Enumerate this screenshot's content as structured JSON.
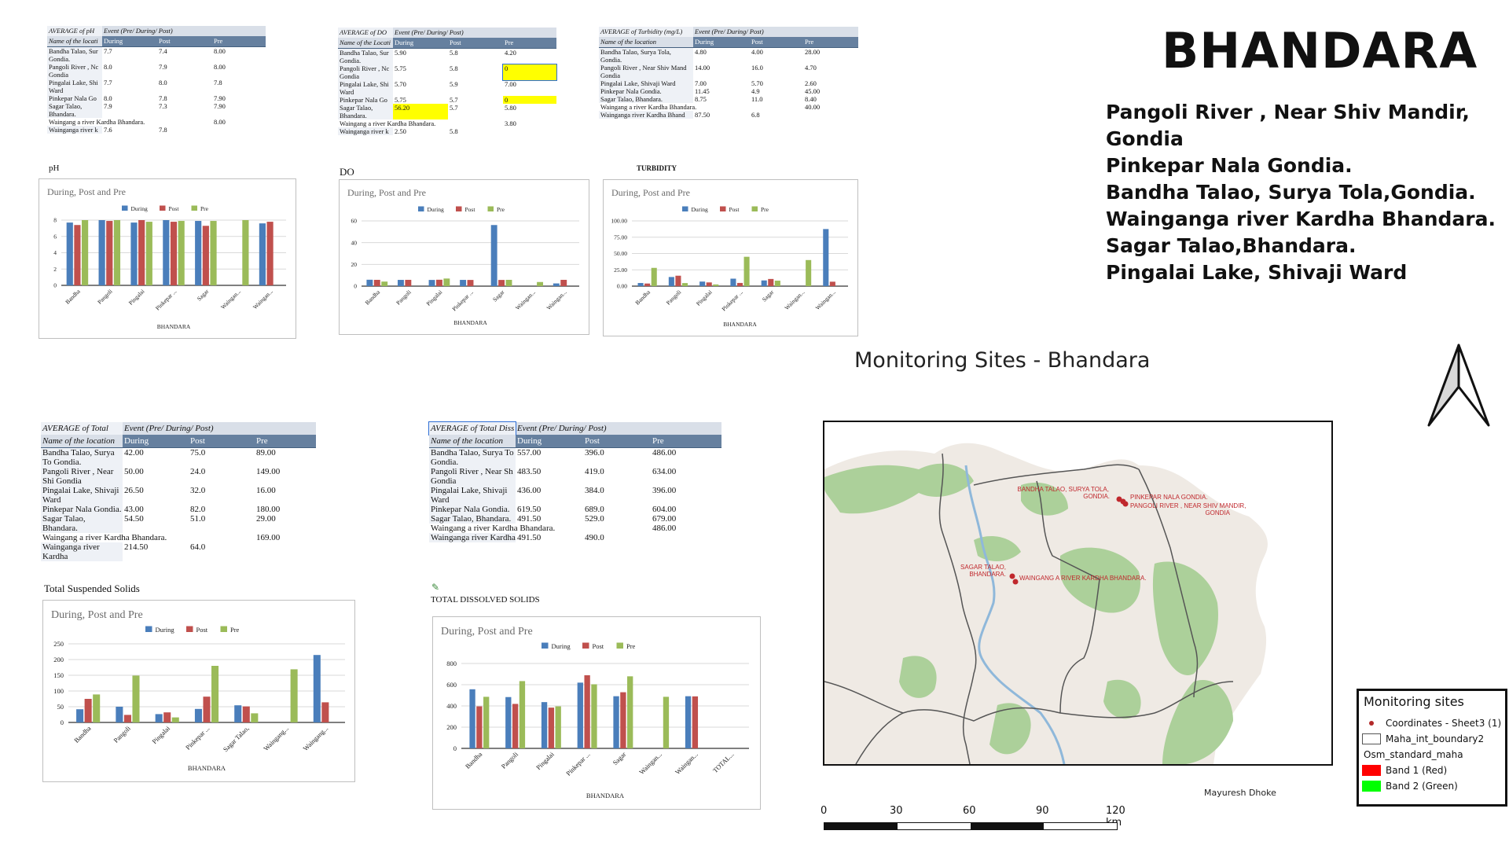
{
  "header": {
    "title": "BHANDARA",
    "sites": [
      "Pangoli River , Near Shiv Mandir,",
      "Gondia",
      "Pinkepar Nala Gondia.",
      "Bandha Talao, Surya Tola,Gondia.",
      "Wainganga river Kardha Bhandara.",
      "Sagar Talao,Bhandara.",
      "Pingalai Lake, Shivaji Ward"
    ]
  },
  "tables": {
    "ph": {
      "h1": "AVERAGE of pH",
      "h1b": "Event (Pre/ During/ Post)",
      "cols": [
        "Name of the locati",
        "During",
        "Post",
        "Pre"
      ],
      "rows": [
        [
          "Bandha Talao, Sur Gondia.",
          "7.7",
          "7.4",
          "8.00"
        ],
        [
          "Pangoli River , Nc Gondia",
          "8.0",
          "7.9",
          "8.00"
        ],
        [
          "Pingalai Lake, Shi Ward",
          "7.7",
          "8.0",
          "7.8"
        ],
        [
          "Pinkepar Nala Go",
          "8.0",
          "7.8",
          "7.90"
        ],
        [
          "Sagar Talao, Bhandara.",
          "7.9",
          "7.3",
          "7.90"
        ],
        [
          "Waingang a river Kardha Bhandara.",
          "",
          "",
          "8.00"
        ],
        [
          "Wainganga river k",
          "7.6",
          "7.8",
          ""
        ]
      ],
      "caption": "pH"
    },
    "do": {
      "h1": "AVERAGE of DO",
      "h1b": "Event (Pre/ During/ Post)",
      "cols": [
        "Name of the Locati",
        "During",
        "Post",
        "Pre"
      ],
      "rows": [
        [
          "Bandha Talao, Sur Gondia.",
          "5.90",
          "5.8",
          "4.20"
        ],
        [
          "Pangoli River , Nc Gondia",
          "5.75",
          "5.8",
          "0"
        ],
        [
          "Pingalai Lake, Shi Ward",
          "5.70",
          "5.9",
          "7.00"
        ],
        [
          "Pinkepar Nala Go",
          "5.75",
          "5.7",
          "0"
        ],
        [
          "Sagar Talao, Bhandara.",
          "56.20",
          "5.7",
          "5.80"
        ],
        [
          "Waingang a river Kardha Bhandara.",
          "",
          "",
          "3.80"
        ],
        [
          "Wainganga river k",
          "2.50",
          "5.8",
          ""
        ]
      ],
      "caption": "DO"
    },
    "turbidity": {
      "h1": "AVERAGE of Turbidity (mg/L)",
      "h1b": "Event (Pre/ During/ Post)",
      "cols": [
        "Name of the location",
        "During",
        "Post",
        "Pre"
      ],
      "rows": [
        [
          "Bandha Talao, Surya Tola, Gondia.",
          "4.80",
          "4.00",
          "28.00"
        ],
        [
          "Pangoli River , Near Shiv Mand Gondia",
          "14.00",
          "16.0",
          "4.70"
        ],
        [
          "Pingalai Lake, Shivaji Ward",
          "7.00",
          "5.70",
          "2.60"
        ],
        [
          "Pinkepar Nala Gondia.",
          "11.45",
          "4.9",
          "45.00"
        ],
        [
          "Sagar Talao, Bhandara.",
          "8.75",
          "11.0",
          "8.40"
        ],
        [
          "Waingang a river Kardha Bhandara.",
          "",
          "",
          "40.00"
        ],
        [
          "Wainganga river Kardha Bhand",
          "87.50",
          "6.8",
          ""
        ]
      ],
      "caption": "TURBIDITY"
    },
    "tss": {
      "h1": "AVERAGE of Total Susp",
      "h1b": "Event (Pre/ During/ Post)",
      "cols": [
        "Name of the location",
        "During",
        "Post",
        "Pre"
      ],
      "rows": [
        [
          "Bandha Talao, Surya To Gondia.",
          "42.00",
          "75.0",
          "89.00"
        ],
        [
          "Pangoli River , Near Shi Gondia",
          "50.00",
          "24.0",
          "149.00"
        ],
        [
          "Pingalai Lake, Shivaji Ward",
          "26.50",
          "32.0",
          "16.00"
        ],
        [
          "Pinkepar Nala Gondia.",
          "43.00",
          "82.0",
          "180.00"
        ],
        [
          "Sagar Talao, Bhandara.",
          "54.50",
          "51.0",
          "29.00"
        ],
        [
          "Waingang a river Kardha Bhandara.",
          "",
          "",
          "169.00"
        ],
        [
          "Wainganga river Kardha",
          "214.50",
          "64.0",
          ""
        ]
      ],
      "caption": "Total Suspended Solids"
    },
    "tds": {
      "h1": "AVERAGE of Total Diss",
      "h1b": "Event (Pre/ During/ Post)",
      "cols": [
        "Name of the location",
        "During",
        "Post",
        "Pre"
      ],
      "rows": [
        [
          "Bandha Talao, Surya To Gondia.",
          "557.00",
          "396.0",
          "486.00"
        ],
        [
          "Pangoli River , Near Sh Gondia",
          "483.50",
          "419.0",
          "634.00"
        ],
        [
          "Pingalai Lake, Shivaji Ward",
          "436.00",
          "384.0",
          "396.00"
        ],
        [
          "Pinkepar Nala Gondia.",
          "619.50",
          "689.0",
          "604.00"
        ],
        [
          "Sagar Talao, Bhandara.",
          "491.50",
          "529.0",
          "679.00"
        ],
        [
          "Waingang a river Kardha Bhandara.",
          "",
          "",
          "486.00"
        ],
        [
          "Wainganga river Kardha",
          "491.50",
          "490.0",
          ""
        ]
      ],
      "caption": "TOTAL DISSOLVED SOLIDS"
    }
  },
  "colors": {
    "during": "#4a7ebb",
    "post": "#c0504d",
    "pre": "#9bbb59",
    "header": "#66809f",
    "highlight": "#ffff00"
  },
  "chart_data": [
    {
      "id": "ph",
      "type": "bar",
      "title": "During, Post and Pre",
      "xlabel": "BHANDARA",
      "ylabel": "",
      "categories": [
        "Bandha",
        "Pangoli",
        "Pingalai",
        "Pinkepar ...",
        "Sagar",
        "Waingan...",
        "Waingan..."
      ],
      "series": [
        {
          "name": "During",
          "values": [
            7.7,
            8.0,
            7.7,
            8.0,
            7.9,
            null,
            7.6
          ]
        },
        {
          "name": "Post",
          "values": [
            7.4,
            7.9,
            8.0,
            7.8,
            7.3,
            null,
            7.8
          ]
        },
        {
          "name": "Pre",
          "values": [
            8.0,
            8.0,
            7.8,
            7.9,
            7.9,
            8.0,
            null
          ]
        }
      ],
      "ylim": [
        0,
        8
      ],
      "yticks": [
        "0",
        "2",
        "4",
        "6",
        "8"
      ],
      "grid": true,
      "legend": "top-center"
    },
    {
      "id": "do",
      "type": "bar",
      "title": "During, Post and Pre",
      "xlabel": "BHANDARA",
      "ylabel": "",
      "categories": [
        "Bandha",
        "Pangoli",
        "Pingalai",
        "Pinkepar ...",
        "Sagar",
        "Waingan...",
        "Waingan..."
      ],
      "series": [
        {
          "name": "During",
          "values": [
            5.9,
            5.75,
            5.7,
            5.75,
            56.2,
            null,
            2.5
          ]
        },
        {
          "name": "Post",
          "values": [
            5.8,
            5.8,
            5.9,
            5.7,
            5.7,
            null,
            5.8
          ]
        },
        {
          "name": "Pre",
          "values": [
            4.2,
            0,
            7.0,
            0,
            5.8,
            3.8,
            null
          ]
        }
      ],
      "ylim": [
        0,
        60
      ],
      "yticks": [
        "0",
        "20",
        "40",
        "60"
      ],
      "grid": true,
      "legend": "top-center"
    },
    {
      "id": "turbidity",
      "type": "bar",
      "title": "During, Post and Pre",
      "xlabel": "BHANDARA",
      "ylabel": "",
      "categories": [
        "Bandha",
        "Pangoli",
        "Pingalai",
        "Pinkepar ...",
        "Sagar",
        "Waingan...",
        "Waingan..."
      ],
      "series": [
        {
          "name": "During",
          "values": [
            4.8,
            14.0,
            7.0,
            11.45,
            8.75,
            null,
            87.5
          ]
        },
        {
          "name": "Post",
          "values": [
            4.0,
            16.0,
            5.7,
            4.9,
            11.0,
            null,
            6.8
          ]
        },
        {
          "name": "Pre",
          "values": [
            28.0,
            4.7,
            2.6,
            45.0,
            8.4,
            40.0,
            null
          ]
        }
      ],
      "ylim": [
        0,
        100
      ],
      "yticks": [
        "0.00",
        "25.00",
        "50.00",
        "75.00",
        "100.00"
      ],
      "grid": true,
      "legend": "top-center"
    },
    {
      "id": "tss",
      "type": "bar",
      "title": "During, Post and Pre",
      "xlabel": "BHANDARA",
      "ylabel": "",
      "categories": [
        "Bandha",
        "Pangoli",
        "Pingalai",
        "Pinkepar ...",
        "Sagar Talao,",
        "Waingang...",
        "Waingang..."
      ],
      "series": [
        {
          "name": "During",
          "values": [
            42.0,
            50.0,
            26.5,
            43.0,
            54.5,
            null,
            214.5
          ]
        },
        {
          "name": "Post",
          "values": [
            75.0,
            24.0,
            32.0,
            82.0,
            51.0,
            null,
            64.0
          ]
        },
        {
          "name": "Pre",
          "values": [
            89.0,
            149.0,
            16.0,
            180.0,
            29.0,
            169.0,
            null
          ]
        }
      ],
      "ylim": [
        0,
        250
      ],
      "yticks": [
        "0",
        "50",
        "100",
        "150",
        "200",
        "250"
      ],
      "grid": true,
      "legend": "top-center"
    },
    {
      "id": "tds",
      "type": "bar",
      "title": "During, Post and Pre",
      "xlabel": "BHANDARA",
      "ylabel": "",
      "categories": [
        "Bandha",
        "Pangoli",
        "Pingalai",
        "Pinkepar ...",
        "Sagar",
        "Waingan...",
        "Waingan...",
        "TOTAL..."
      ],
      "series": [
        {
          "name": "During",
          "values": [
            557.0,
            483.5,
            436.0,
            619.5,
            491.5,
            null,
            491.5,
            null
          ]
        },
        {
          "name": "Post",
          "values": [
            396.0,
            419.0,
            384.0,
            689.0,
            529.0,
            null,
            490.0,
            null
          ]
        },
        {
          "name": "Pre",
          "values": [
            486.0,
            634.0,
            396.0,
            604.0,
            679.0,
            486.0,
            null,
            null
          ]
        }
      ],
      "ylim": [
        0,
        800
      ],
      "yticks": [
        "0",
        "200",
        "400",
        "600",
        "800"
      ],
      "grid": true,
      "legend": "top-center"
    }
  ],
  "map": {
    "title": "Monitoring Sites - Bhandara",
    "labels": [
      "BANDHA TALAO, SURYA TOLA,",
      "GONDIA.",
      "PINKEPAR NALA GONDIA.",
      "PANGOLI RIVER , NEAR SHIV MANDIR,",
      "GONDIA",
      "SAGAR TALAO,",
      "BHANDARA.",
      "WAINGANG A RIVER KARDHA BHANDARA."
    ],
    "legend": {
      "title": "Monitoring sites",
      "items": [
        "Coordinates - Sheet3 (1)",
        "Maha_int_boundary2",
        "Osm_standard_maha",
        "Band 1 (Red)",
        "Band 2 (Green)"
      ]
    },
    "scale": {
      "ticks": [
        "0",
        "30",
        "60",
        "90",
        "120 km"
      ]
    },
    "author": "Mayuresh Dhoke"
  }
}
